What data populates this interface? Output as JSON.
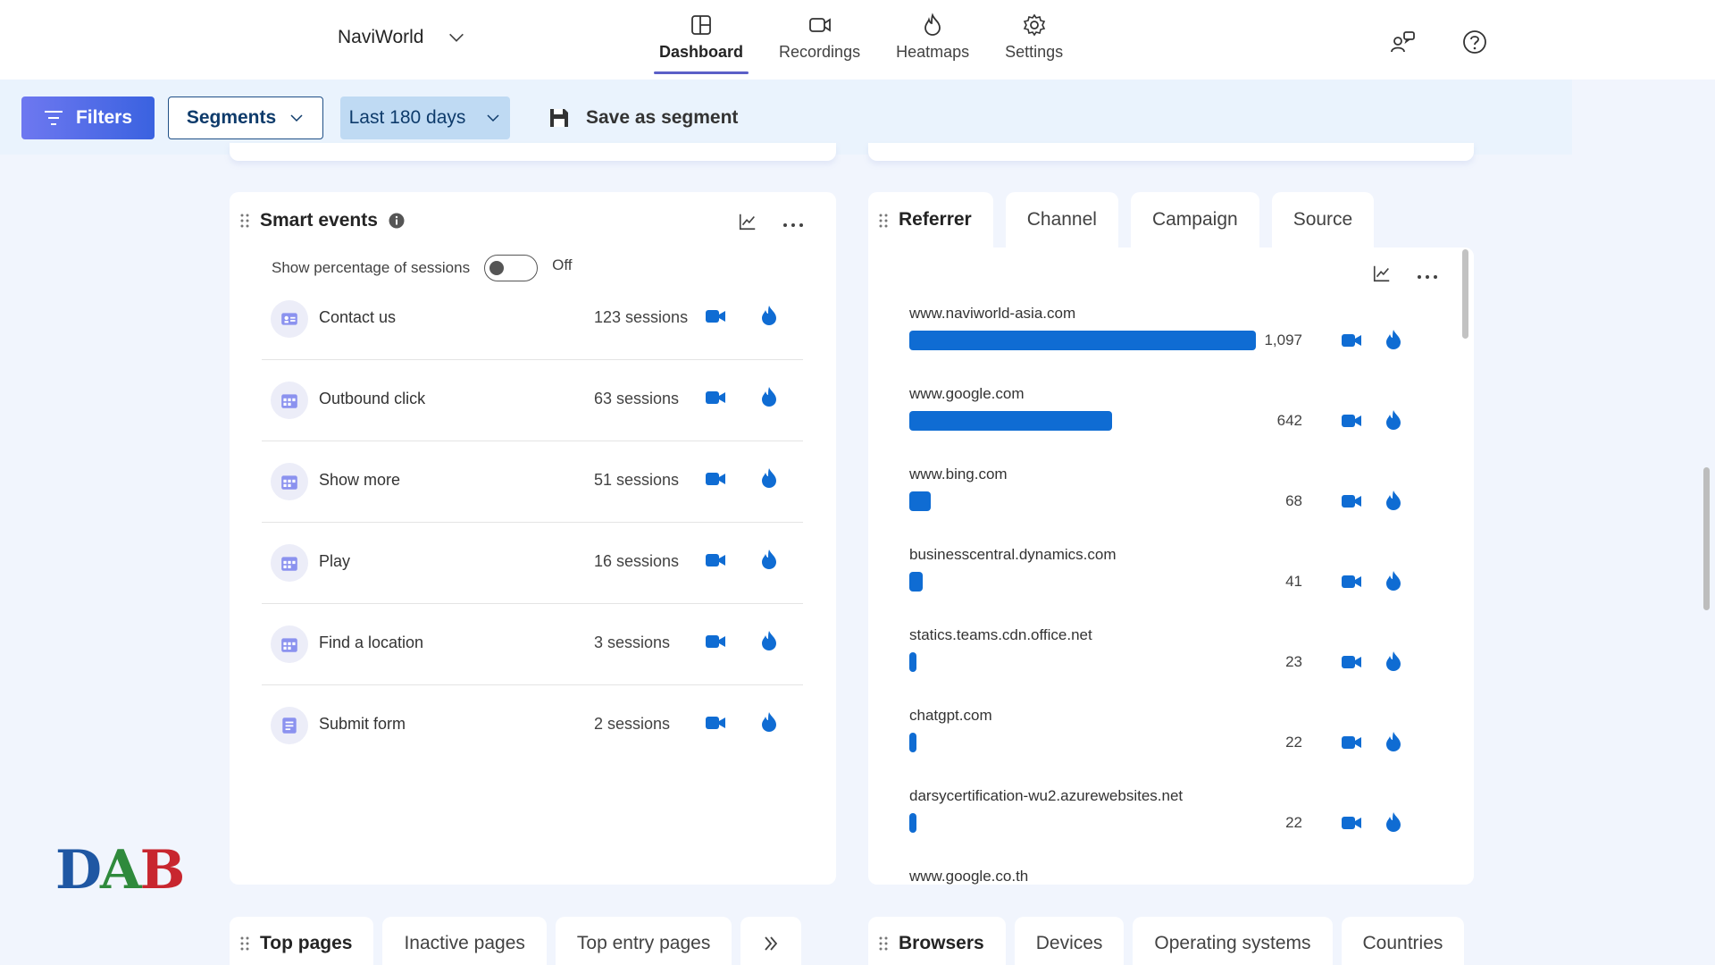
{
  "header": {
    "workspace": "NaviWorld",
    "tabs": [
      {
        "label": "Dashboard",
        "icon": "dashboard-icon",
        "active": true
      },
      {
        "label": "Recordings",
        "icon": "video-camera-icon",
        "active": false
      },
      {
        "label": "Heatmaps",
        "icon": "flame-icon",
        "active": false
      },
      {
        "label": "Settings",
        "icon": "gear-icon",
        "active": false
      }
    ]
  },
  "filterbar": {
    "filters_label": "Filters",
    "segments_label": "Segments",
    "date_range": "Last 180 days",
    "save_label": "Save as segment"
  },
  "smart_events": {
    "title": "Smart events",
    "toggle_label": "Show percentage of sessions",
    "toggle_state": "Off",
    "events": [
      {
        "name": "Contact us",
        "sessions": "123 sessions"
      },
      {
        "name": "Outbound click",
        "sessions": "63 sessions"
      },
      {
        "name": "Show more",
        "sessions": "51 sessions"
      },
      {
        "name": "Play",
        "sessions": "16 sessions"
      },
      {
        "name": "Find a location",
        "sessions": "3 sessions"
      },
      {
        "name": "Submit form",
        "sessions": "2 sessions"
      }
    ]
  },
  "referrer": {
    "tabs": [
      "Referrer",
      "Channel",
      "Campaign",
      "Source"
    ],
    "max_value": 1097,
    "items": [
      {
        "domain": "www.naviworld-asia.com",
        "value": 1097,
        "display": "1,097"
      },
      {
        "domain": "www.google.com",
        "value": 642,
        "display": "642"
      },
      {
        "domain": "www.bing.com",
        "value": 68,
        "display": "68"
      },
      {
        "domain": "businesscentral.dynamics.com",
        "value": 41,
        "display": "41"
      },
      {
        "domain": "statics.teams.cdn.office.net",
        "value": 23,
        "display": "23"
      },
      {
        "domain": "chatgpt.com",
        "value": 22,
        "display": "22"
      },
      {
        "domain": "darsycertification-wu2.azurewebsites.net",
        "value": 22,
        "display": "22"
      },
      {
        "domain": "www.google.co.th",
        "value": 0,
        "display": ""
      }
    ]
  },
  "bottom_left_tabs": [
    "Top pages",
    "Inactive pages",
    "Top entry pages"
  ],
  "bottom_right_tabs": [
    "Browsers",
    "Devices",
    "Operating systems",
    "Countries"
  ],
  "logo": {
    "d": "D",
    "a": "A",
    "b": "B"
  },
  "colors": {
    "accent": "#0f6cd3",
    "nav_underline": "#5b5fc7",
    "filters_start": "#6e78f0",
    "filters_end": "#3a62e0"
  }
}
